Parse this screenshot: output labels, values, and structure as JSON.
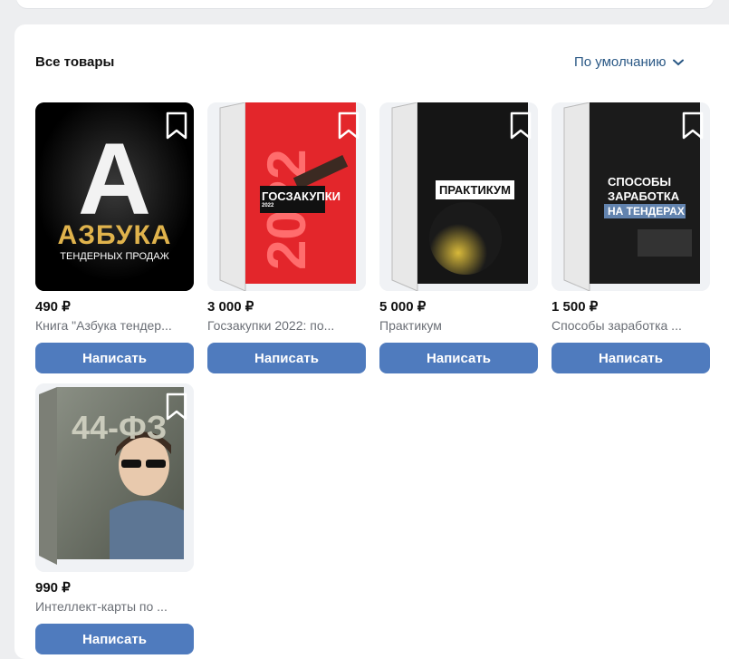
{
  "section": {
    "title": "Все товары",
    "sort_label": "По умолчанию"
  },
  "products": [
    {
      "price": "490 ₽",
      "name": "Книга \"Азбука тендер...",
      "button": "Написать",
      "cover": {
        "big": "А",
        "line1": "АЗБУКА",
        "line2": "ТЕНДЕРНЫХ ПРОДАЖ"
      }
    },
    {
      "price": "3 000 ₽",
      "name": "Госзакупки 2022: по...",
      "button": "Написать",
      "cover": {
        "label": "ГОСЗАКУПКИ",
        "year": "2022"
      }
    },
    {
      "price": "5 000 ₽",
      "name": "Практикум",
      "button": "Написать",
      "cover": {
        "label": "ПРАКТИКУМ"
      }
    },
    {
      "price": "1 500 ₽",
      "name": "Способы заработка ...",
      "button": "Написать",
      "cover": {
        "line1": "СПОСОБЫ",
        "line2": "ЗАРАБОТКА",
        "line3": "НА ТЕНДЕРАХ"
      }
    },
    {
      "price": "990 ₽",
      "name": "Интеллект-карты по ...",
      "button": "Написать",
      "cover": {
        "label": "44-ФЗ"
      }
    }
  ],
  "colors": {
    "accent": "#4f7bbe",
    "link": "#2a5885",
    "background": "#edeef0"
  }
}
